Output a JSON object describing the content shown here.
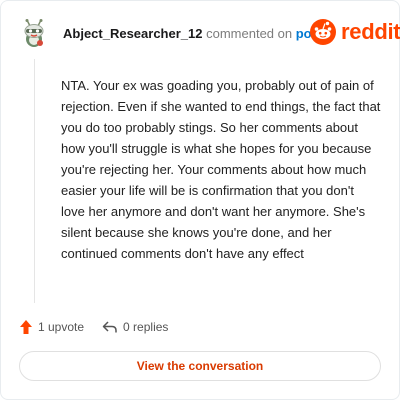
{
  "comment": {
    "username": "Abject_Researcher_12",
    "commented_text": "commented on",
    "post_link": "post",
    "body": "NTA. Your ex was goading you, probably out of pain of rejection. Even if she wanted to end things, the fact that you do too probably stings. So her comments about how you'll struggle is what she hopes for you because you're rejecting her. Your comments about how much easier your life will be is confirmation that you don't love her anymore and don't want her anymore. She's silent because she knows you're done, and her continued comments don't have any effect"
  },
  "brand": {
    "name": "reddit",
    "color": "#ff4500",
    "icon": "reddit-snoo-icon"
  },
  "actions": {
    "upvotes": "1 upvote",
    "replies": "0 replies",
    "upvote_icon": "upvote-arrow-icon",
    "reply_icon": "reply-icon"
  },
  "cta": {
    "label": "View the conversation"
  },
  "colors": {
    "accent": "#ff4500",
    "link": "#0079d3",
    "cta_text": "#d93a00"
  }
}
